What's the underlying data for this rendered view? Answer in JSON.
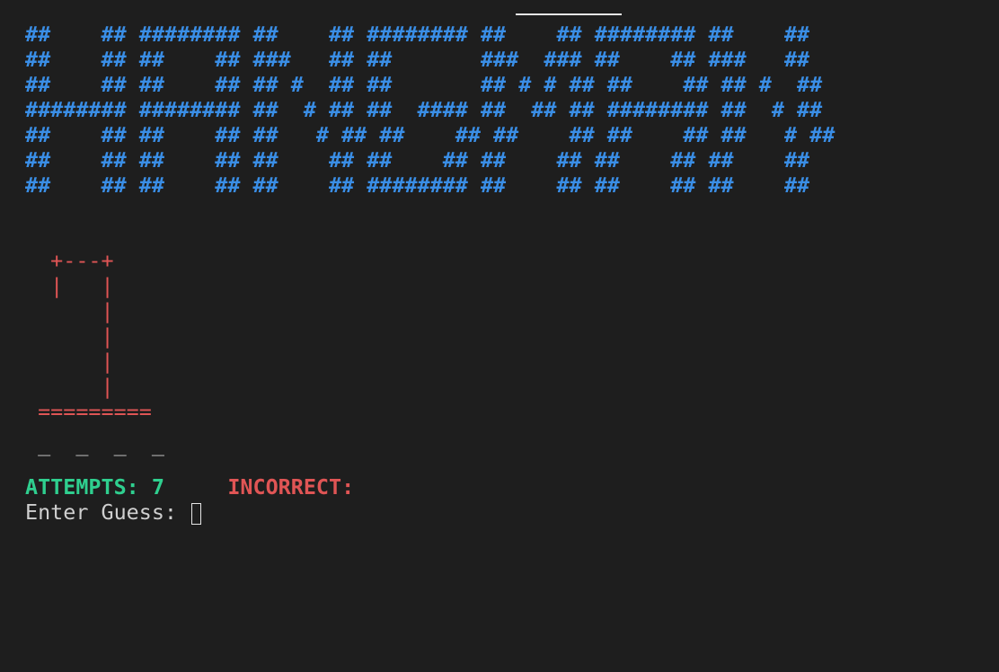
{
  "banner": {
    "lines": [
      "##    ## ######## ##    ## ######## ##    ## ######## ##    ##",
      "##    ## ##    ## ###   ## ##       ###  ### ##    ## ###   ##",
      "##    ## ##    ## ## #  ## ##       ## # # ## ##    ## ## #  ##",
      "######## ######## ##  # ## ##  #### ##  ## ## ######## ##  # ##",
      "##    ## ##    ## ##   # ## ##    ## ##    ## ##    ## ##   # ##",
      "##    ## ##    ## ##    ## ##    ## ##    ## ##    ## ##    ##",
      "##    ## ##    ## ##    ## ######## ##    ## ##    ## ##    ##"
    ]
  },
  "gallows": {
    "lines": [
      "  +---+",
      "  |   |",
      "      |",
      "      |",
      "      |",
      "      |",
      " ========="
    ]
  },
  "word": {
    "display": " _  _  _  _"
  },
  "status": {
    "attempts_label": "ATTEMPTS: 7",
    "incorrect_label": "INCORRECT:"
  },
  "prompt": {
    "label": "Enter Guess: "
  },
  "colors": {
    "background": "#1e1e1e",
    "banner": "#3a8ee6",
    "gallows": "#e05555",
    "attempts": "#2fcf8f",
    "incorrect": "#e05555",
    "text": "#cfcfcf"
  }
}
